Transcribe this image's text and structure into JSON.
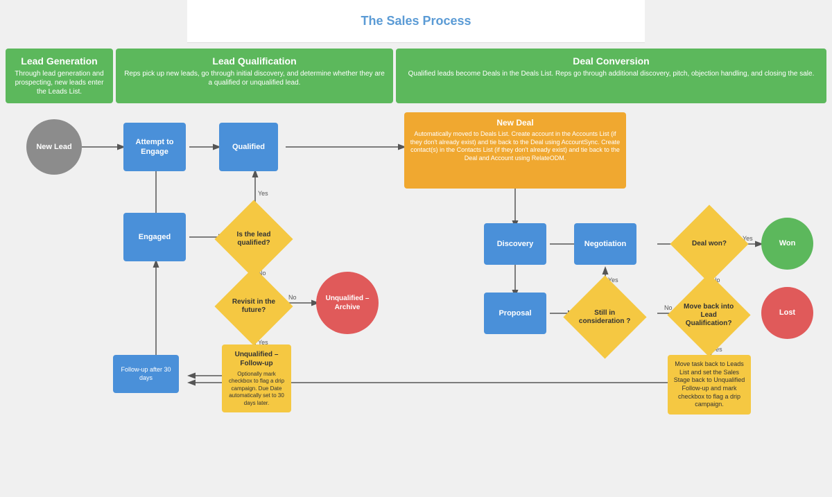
{
  "title": "The Sales Process",
  "stages": [
    {
      "id": "lead-gen",
      "label": "Lead Generation",
      "description": "Through lead generation and prospecting, new leads enter the Leads List."
    },
    {
      "id": "lead-qual",
      "label": "Lead Qualification",
      "description": "Reps pick up new leads, go through initial discovery, and determine whether they are a qualified or unqualified lead."
    },
    {
      "id": "deal-conv",
      "label": "Deal Conversion",
      "description": "Qualified leads become Deals in the Deals List. Reps go through additional discovery, pitch, objection handling, and closing the sale."
    }
  ],
  "nodes": {
    "new_lead": "New Lead",
    "attempt_to_engage": "Attempt to\nEngage",
    "engaged": "Engaged",
    "qualified": "Qualified",
    "is_lead_qualified": "Is the lead\nqualified?",
    "revisit_future": "Revisit in the\nfuture?",
    "unqualified_archive": "Unqualified –\nArchive",
    "unqualified_followup": "Unqualified –\nFollow-up",
    "new_deal": "New Deal",
    "new_deal_desc": "Automatically moved to Deals List. Create account in the Accounts List (if they don't already exist) and tie back to the Deal using AccountSync. Create contact(s) in the Contacts List (if they don't already exist) and tie back to the Deal and Account using RelateODM.",
    "discovery": "Discovery",
    "negotiation": "Negotiation",
    "proposal": "Proposal",
    "still_in_consideration": "Still in\nconsideration\n?",
    "deal_won": "Deal won?",
    "won": "Won",
    "move_back_lead_qual": "Move back\ninto Lead\nQualification?",
    "lost": "Lost",
    "followup_30": "Follow-up after 30 days",
    "move_back_leads": "Move task back to Leads List and set the Sales Stage back to Unqualified Follow-up and mark checkbox to flag a drip campaign.",
    "yes": "Yes",
    "no": "No"
  }
}
